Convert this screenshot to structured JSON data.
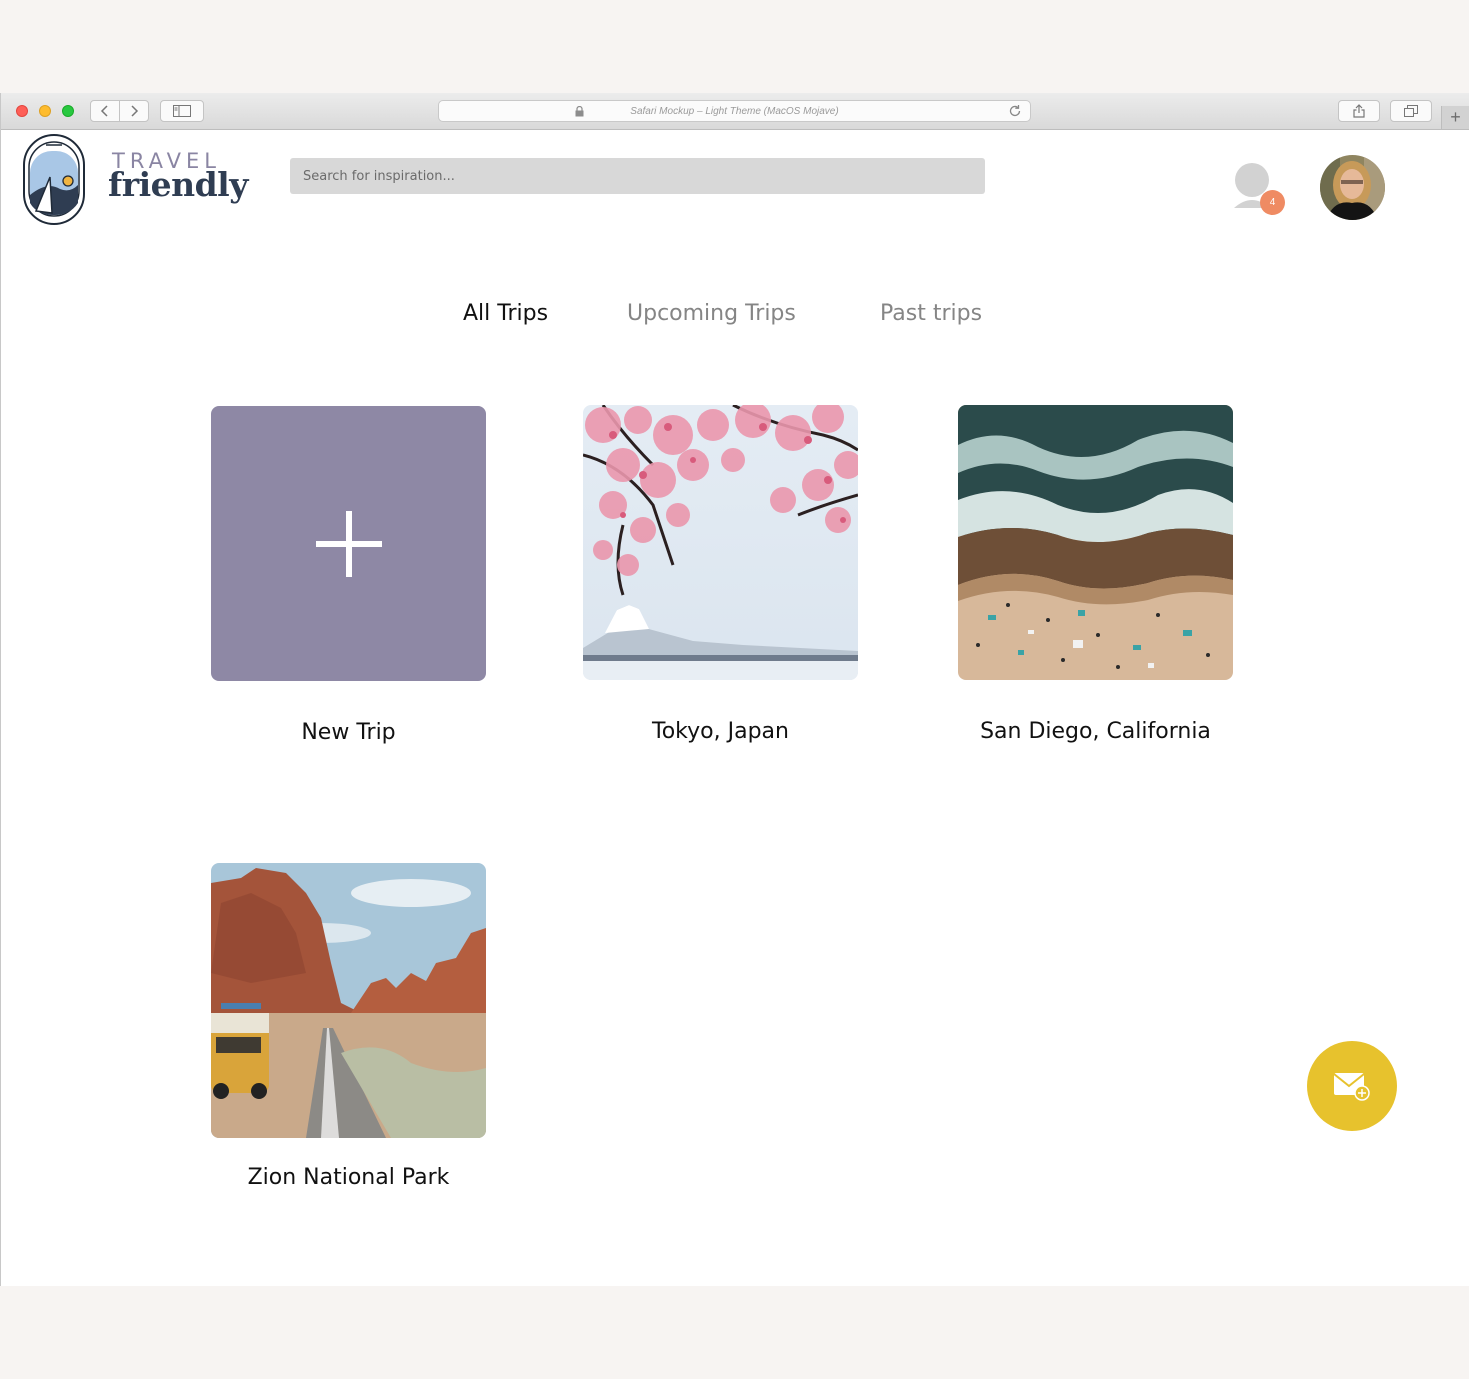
{
  "browser": {
    "address_text": "Safari Mockup – Light Theme (MacOS Mojave)",
    "new_tab_symbol": "+"
  },
  "brand": {
    "line1": "TRAVEL",
    "line2": "friendly"
  },
  "search": {
    "placeholder": "Search for inspiration..."
  },
  "notifications": {
    "count": "4",
    "badge_color": "#ef8b63"
  },
  "tabs": [
    {
      "label": "All Trips",
      "active": true
    },
    {
      "label": "Upcoming Trips",
      "active": false
    },
    {
      "label": "Past trips",
      "active": false
    }
  ],
  "trips": [
    {
      "label": "New Trip",
      "icon": "plus-icon",
      "color": "#8e88a5"
    },
    {
      "label": "Tokyo, Japan"
    },
    {
      "label": "San Diego, California"
    },
    {
      "label": "Zion National Park"
    }
  ],
  "fab": {
    "icon": "mail-add-icon",
    "color": "#e7c22d"
  }
}
